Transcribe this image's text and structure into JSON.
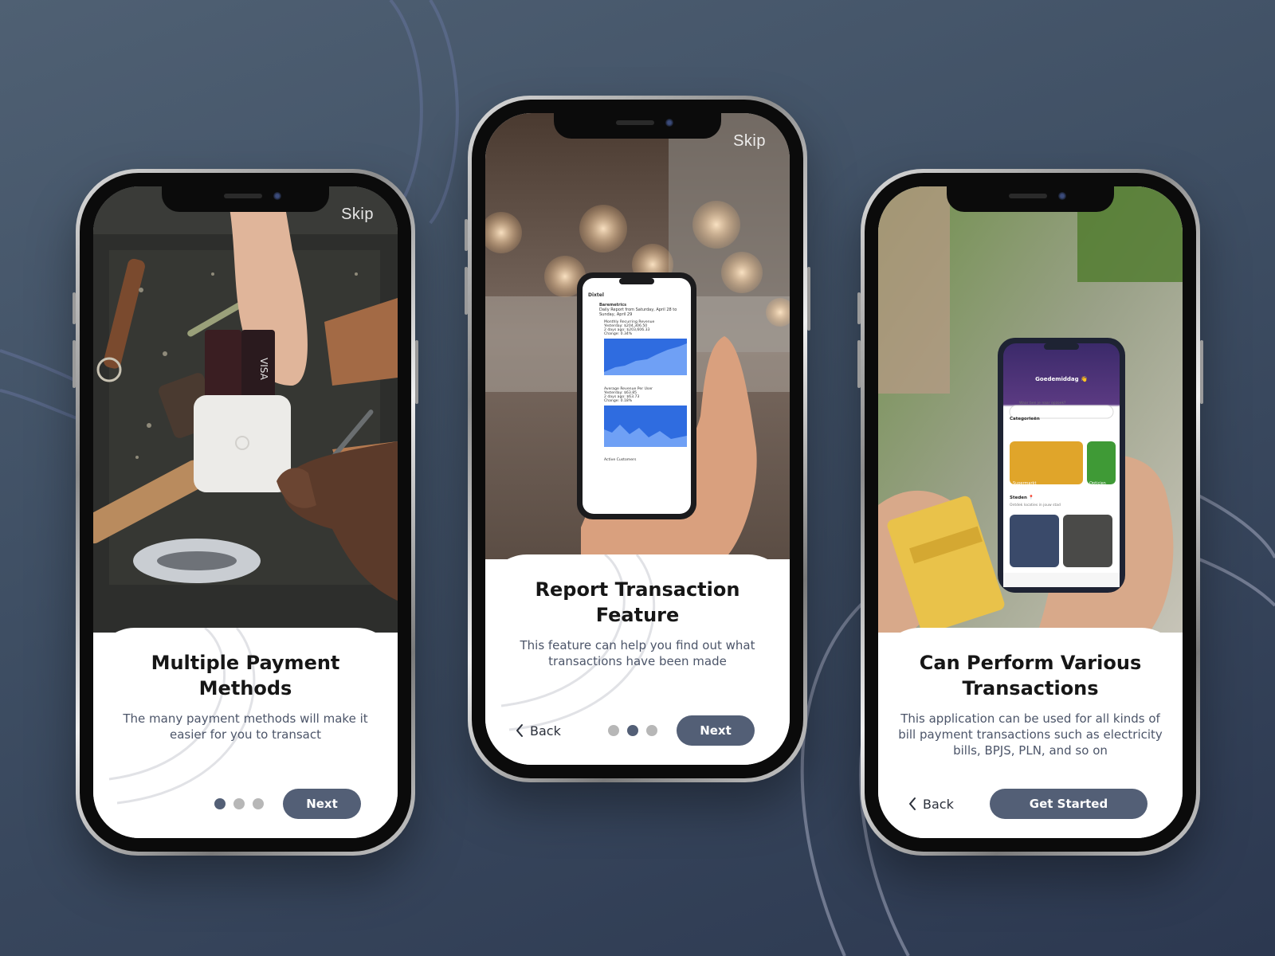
{
  "screens": [
    {
      "skip_label": "Skip",
      "title": "Multiple Payment Methods",
      "description": "The many payment methods will make it easier for you to transact",
      "primary_button": "Next",
      "active_dot": 1,
      "photo_icon": "card-payment-photo"
    },
    {
      "skip_label": "Skip",
      "title": "Report Transaction Feature",
      "description": "This feature can help you find out what transactions have been made",
      "back_label": "Back",
      "primary_button": "Next",
      "active_dot": 2,
      "photo_icon": "phone-report-photo",
      "photo_phone_text": {
        "app_name": "Dixtel",
        "report_name": "Baremetrics",
        "report_line": "Daily Report from Saturday, April 28 to Sunday, April 29",
        "metric_1": "Monthly Recurring Revenue",
        "metric_1_values": [
          "Yesterday: $204,306.50",
          "2 days ago: $203,606.33",
          "Change: 0.34%"
        ],
        "metric_2": "Average Revenue Per User",
        "metric_2_values": [
          "Yesterday: $63.85",
          "2 days ago: $63.73",
          "Change: 0.18%"
        ],
        "metric_3": "Active Customers"
      }
    },
    {
      "title": "Can Perform Various Transactions",
      "description": "This application can be used for all kinds of bill payment transactions such as electricity bills, BPJS, PLN, and so on",
      "back_label": "Back",
      "primary_button": "Get Started",
      "photo_icon": "phone-app-photo",
      "photo_phone_text": {
        "greeting": "Goedemiddag 👋",
        "search_placeholder": "Waar ben je naar opzoek?",
        "section_1": "Categorieën",
        "category_1": "Supermarkt",
        "category_2": "Opticien",
        "section_2": "Steden 📍",
        "section_2_sub": "Ontdek locaties in jouw stad"
      }
    }
  ],
  "colors": {
    "background_top": "#4f6073",
    "background_bottom": "#2c3850",
    "button": "#535f76",
    "dot_inactive": "#b7b7b7"
  }
}
